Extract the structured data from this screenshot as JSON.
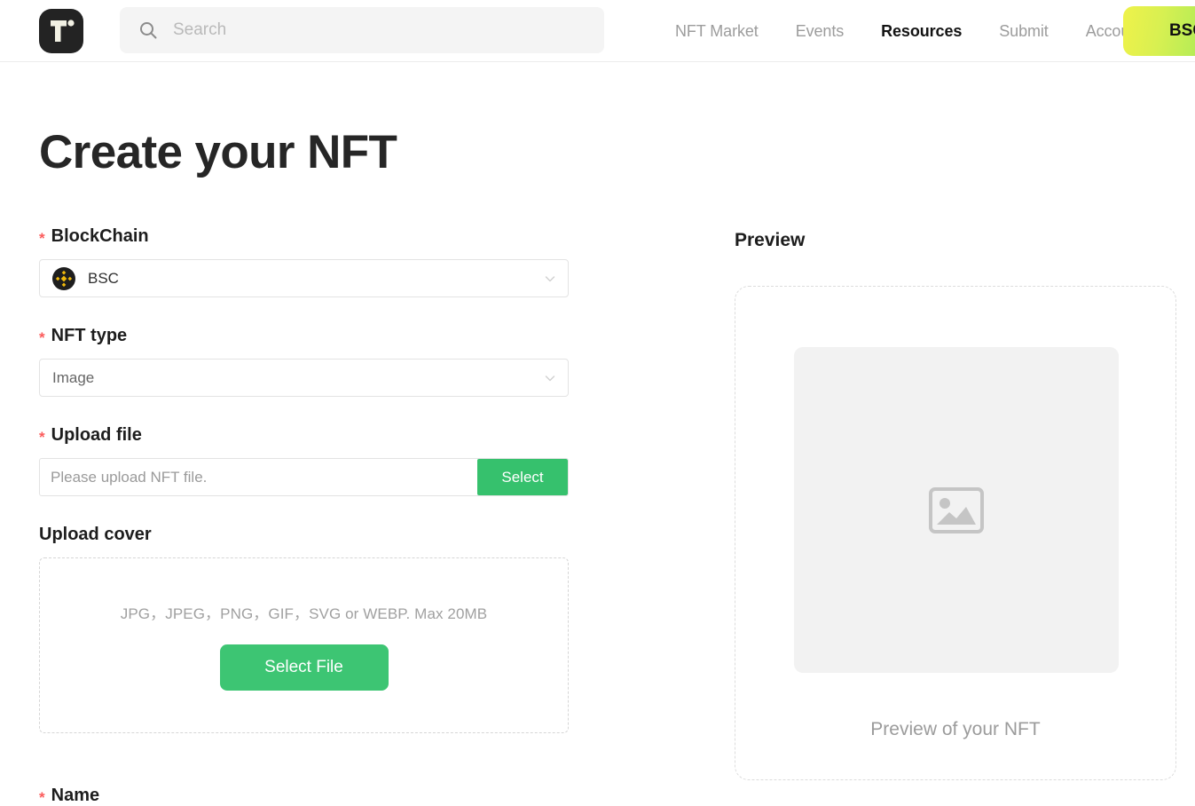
{
  "header": {
    "logo_name": "tofu-logo",
    "search": {
      "placeholder": "Search",
      "value": "",
      "icon": "search-icon"
    },
    "nav": [
      {
        "label": "NFT Market",
        "active": false
      },
      {
        "label": "Events",
        "active": false
      },
      {
        "label": "Resources",
        "active": true
      },
      {
        "label": "Submit",
        "active": false
      },
      {
        "label": "Account",
        "active": false
      }
    ],
    "chain_button": {
      "label": "BSC",
      "gradient_from": "#eff24a",
      "gradient_to": "#8ee85c"
    }
  },
  "page": {
    "title": "Create your NFT"
  },
  "form": {
    "blockchain": {
      "label": "BlockChain",
      "required_marker": "*",
      "value": "BSC",
      "icon": "binance-bsc-icon",
      "chevron": "chevron-down-icon"
    },
    "nft_type": {
      "label": "NFT type",
      "required_marker": "*",
      "value": "Image",
      "chevron": "chevron-down-icon"
    },
    "upload_file": {
      "label": "Upload file",
      "required_marker": "*",
      "placeholder": "Please upload NFT file.",
      "value": "",
      "button_label": "Select"
    },
    "upload_cover": {
      "label": "Upload cover",
      "hint": "JPG，JPEG，PNG，GIF，SVG or WEBP. Max 20MB",
      "button_label": "Select File"
    },
    "name": {
      "label": "Name",
      "required_marker": "*"
    }
  },
  "preview": {
    "title": "Preview",
    "placeholder_icon": "image-placeholder-icon",
    "caption": "Preview of your NFT"
  },
  "colors": {
    "accent_green": "#3dc573",
    "required_red": "#fb5b5b",
    "binance_gold": "#f0b90b",
    "logo_dark": "#232323"
  }
}
